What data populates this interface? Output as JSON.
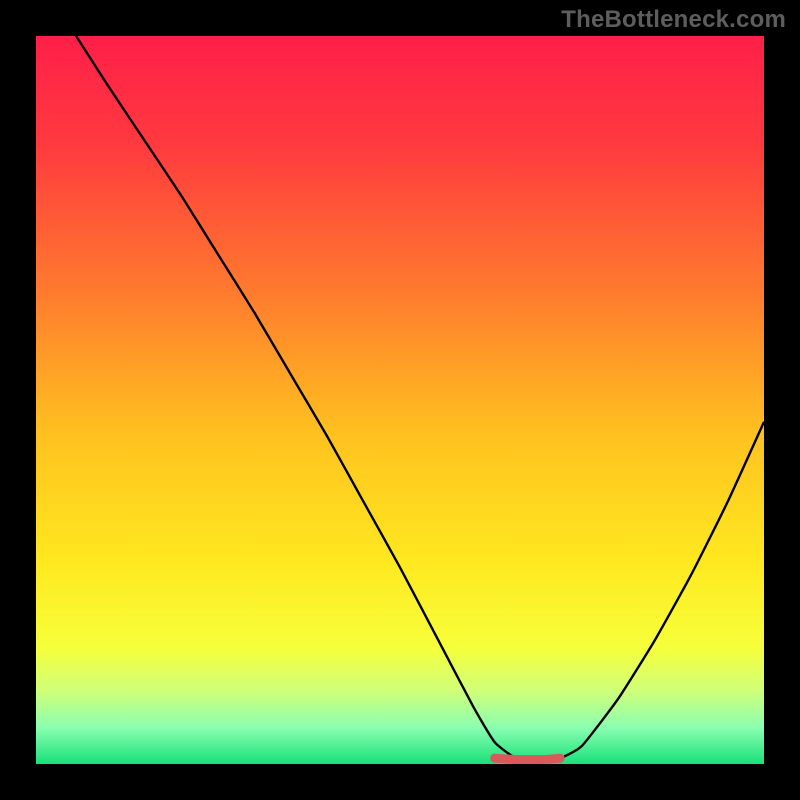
{
  "watermark": "TheBottleneck.com",
  "colors": {
    "frame": "#000000",
    "watermark": "#5d5d5d",
    "gradient_stops": [
      {
        "offset": 0.0,
        "color": "#ff1f49"
      },
      {
        "offset": 0.15,
        "color": "#ff3a3f"
      },
      {
        "offset": 0.35,
        "color": "#ff7a2e"
      },
      {
        "offset": 0.55,
        "color": "#ffc21f"
      },
      {
        "offset": 0.72,
        "color": "#ffe81f"
      },
      {
        "offset": 0.84,
        "color": "#f6ff3a"
      },
      {
        "offset": 0.9,
        "color": "#cfff7a"
      },
      {
        "offset": 0.95,
        "color": "#8affb0"
      },
      {
        "offset": 1.0,
        "color": "#18e07a"
      }
    ],
    "curve_stroke": "#000000",
    "flat_segment": "#d85a5a"
  },
  "chart_data": {
    "type": "line",
    "title": "",
    "xlabel": "",
    "ylabel": "",
    "xlim": [
      0,
      100
    ],
    "ylim": [
      0,
      100
    ],
    "grid": false,
    "note": "Heatmap gradient background (red→green top→bottom) with a V-shaped curve; small flat pink segment at the trough.",
    "series": [
      {
        "name": "curve",
        "x": [
          5.5,
          10,
          15,
          20,
          25,
          30,
          35,
          40,
          45,
          50,
          55,
          60,
          63,
          66,
          70,
          72,
          75,
          80,
          85,
          90,
          95,
          100
        ],
        "y": [
          100,
          93,
          85.5,
          78,
          70,
          62,
          53.5,
          45,
          36,
          27,
          17.5,
          8,
          3,
          0.8,
          0.8,
          0.8,
          2.5,
          9,
          17,
          26,
          36,
          47
        ]
      },
      {
        "name": "flat-segment",
        "x": [
          63,
          66,
          70,
          72
        ],
        "y": [
          0.8,
          0.6,
          0.6,
          0.8
        ]
      }
    ]
  }
}
